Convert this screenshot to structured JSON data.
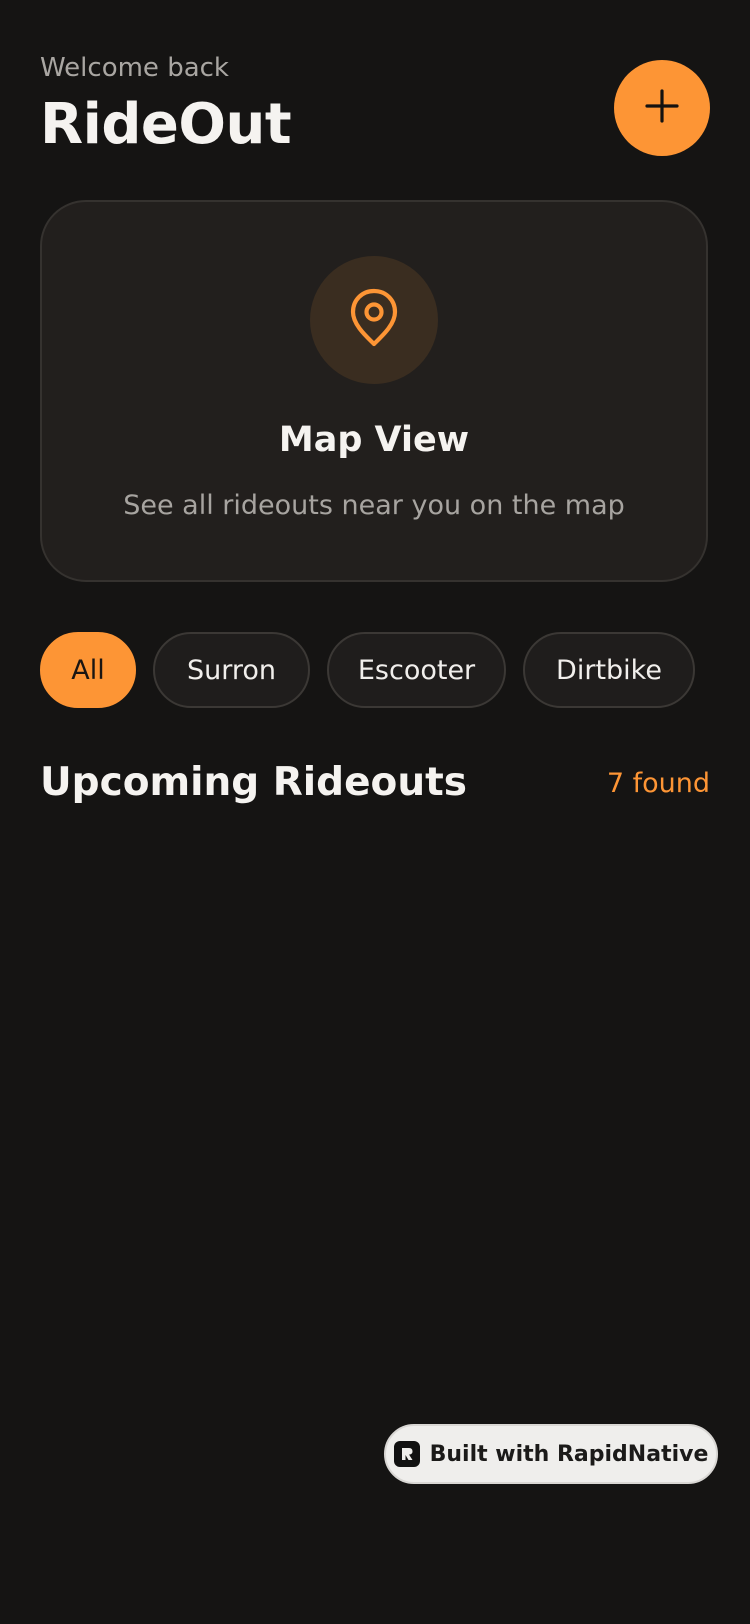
{
  "header": {
    "welcome": "Welcome back",
    "title": "RideOut"
  },
  "add_button": {
    "icon": "plus-icon"
  },
  "map_card": {
    "icon": "map-pin-icon",
    "title": "Map View",
    "subtitle": "See all rideouts near you on the map"
  },
  "filters": {
    "items": [
      {
        "label": "All",
        "active": true
      },
      {
        "label": "Surron",
        "active": false
      },
      {
        "label": "Escooter",
        "active": false
      },
      {
        "label": "Dirtbike",
        "active": false
      }
    ]
  },
  "section": {
    "title": "Upcoming Rideouts",
    "count": "7 found"
  },
  "badge": {
    "icon": "rapidnative-logo-icon",
    "text": "Built with RapidNative"
  },
  "colors": {
    "background": "#151413",
    "accent": "#fd9535",
    "card": "#221f1d"
  }
}
